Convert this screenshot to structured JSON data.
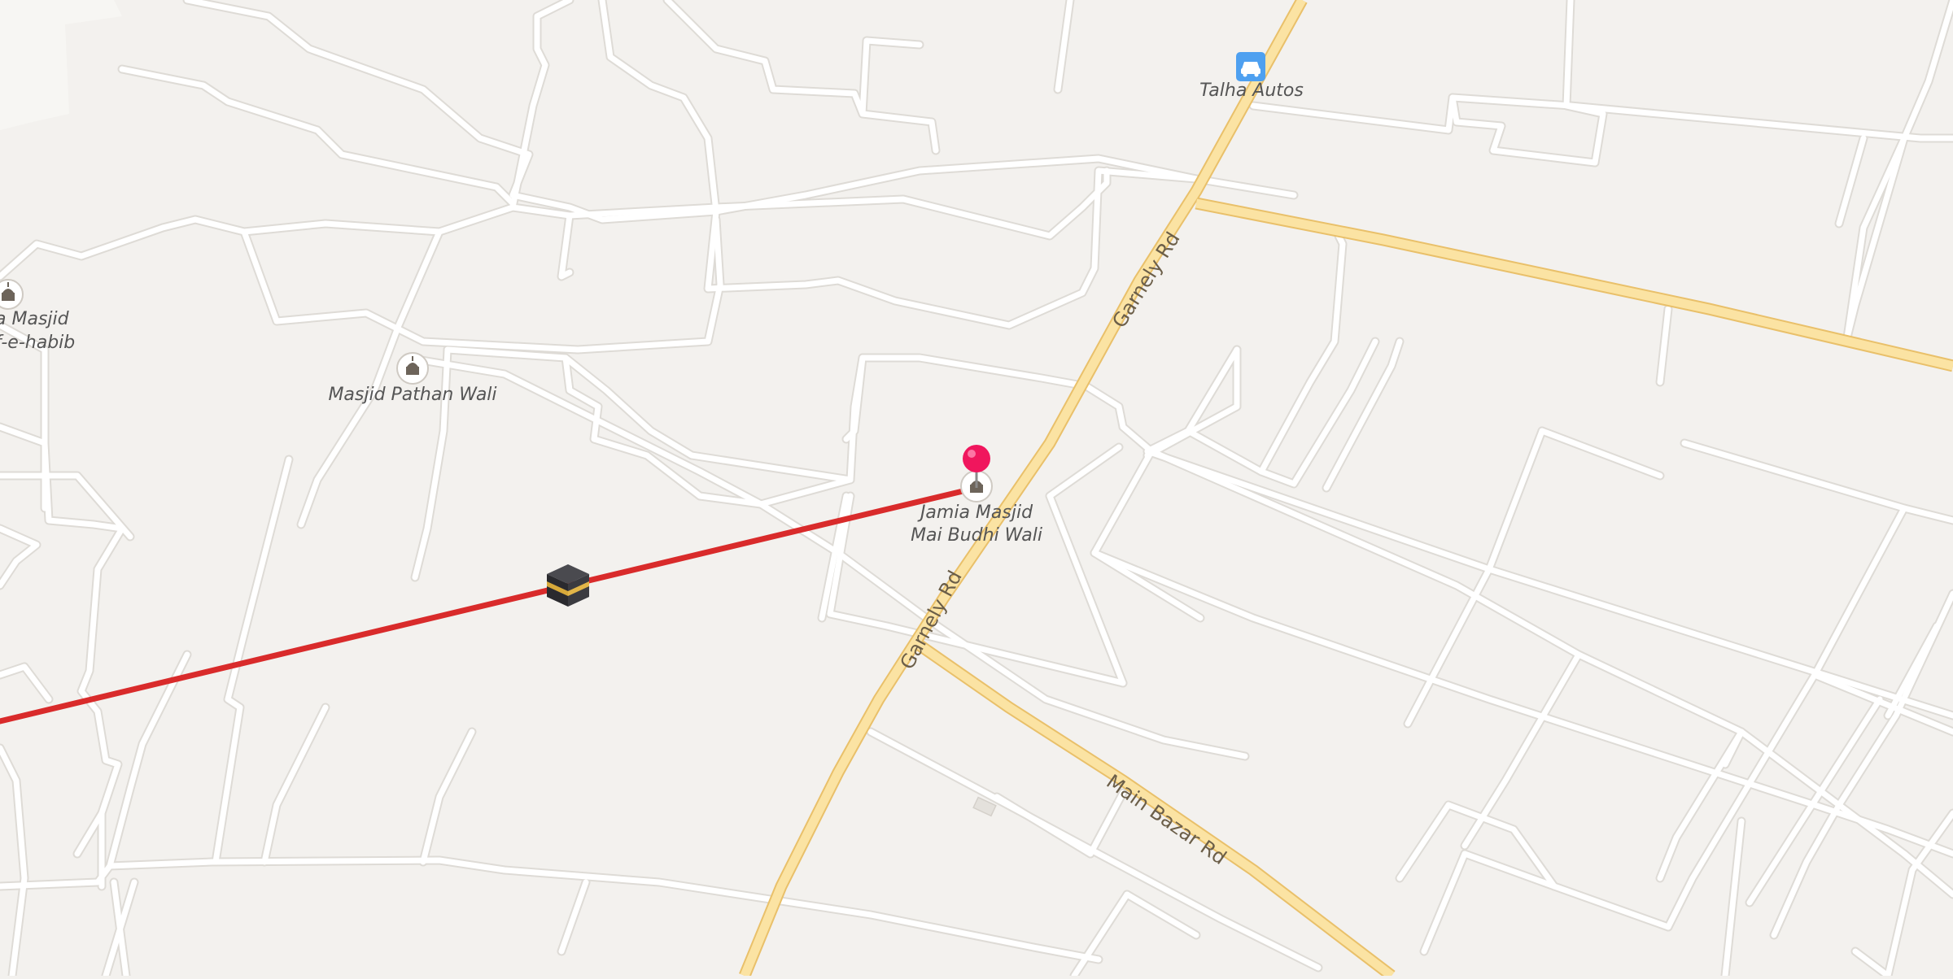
{
  "map": {
    "background": "#f3f1ee",
    "minor_road_color": "#ffffff",
    "major_road_fill": "#fbe3a3",
    "major_road_casing": "#e9c06a",
    "route_color": "#d92b2b",
    "pin_color": "#f0165d"
  },
  "pois": [
    {
      "id": "mosque-left",
      "icon": "mosque-icon",
      "label_lines": [
        "a Masjid",
        "f-e-habib"
      ]
    },
    {
      "id": "mosque-pathan",
      "icon": "mosque-icon",
      "label_lines": [
        "Masjid Pathan Wali"
      ]
    },
    {
      "id": "mosque-jamia",
      "icon": "mosque-icon",
      "label_lines": [
        "Jamia Masjid",
        "Mai Budhi Wali"
      ]
    },
    {
      "id": "talha-autos",
      "icon": "car-icon",
      "label_lines": [
        "Talha Autos"
      ]
    }
  ],
  "roads": {
    "garnely_upper": "Garnely Rd",
    "garnely_lower": "Garnely Rd",
    "main_bazar": "Main Bazar Rd"
  },
  "markers": {
    "destination_pin": "location-pin-icon",
    "qibla_marker": "kaaba-icon"
  }
}
